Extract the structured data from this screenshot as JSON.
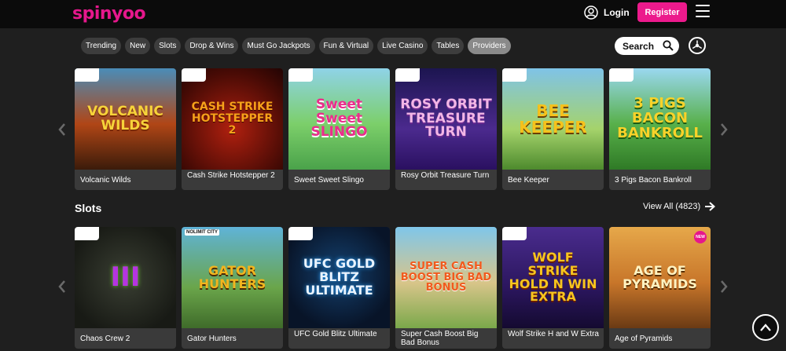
{
  "header": {
    "logo": "spinyoo",
    "login_label": "Login",
    "register_label": "Register",
    "brand_color": "#ec1a8c"
  },
  "tabs": [
    {
      "label": "Trending"
    },
    {
      "label": "New"
    },
    {
      "label": "Slots"
    },
    {
      "label": "Drop & Wins"
    },
    {
      "label": "Must Go Jackpots"
    },
    {
      "label": "Fun & Virtual"
    },
    {
      "label": "Live Casino"
    },
    {
      "label": "Tables"
    },
    {
      "label": "Providers",
      "active": true
    }
  ],
  "search": {
    "label": "Search"
  },
  "featured": {
    "games": [
      {
        "name": "Volcanic Wilds",
        "art": "VOLCANIC WILDS"
      },
      {
        "name": "Cash Strike Hotstepper 2",
        "art": "CASH STRIKE HOTSTEPPER 2"
      },
      {
        "name": "Sweet Sweet Slingo",
        "art": "Sweet Sweet SLINGO"
      },
      {
        "name": "Rosy Orbit Treasure Turn",
        "art": "ROSY ORBIT TREASURE TURN"
      },
      {
        "name": "Bee Keeper",
        "art": "BEE KEEPER"
      },
      {
        "name": "3 Pigs Bacon Bankroll",
        "art": "3 PIGS BACON BANKROLL"
      }
    ]
  },
  "slots": {
    "title": "Slots",
    "view_all_label": "View All (4823)",
    "games": [
      {
        "name": "Chaos Crew 2",
        "art": "III"
      },
      {
        "name": "Gator Hunters",
        "art": "GATOR HUNTERS",
        "provider": "NOLIMIT CITY"
      },
      {
        "name": "UFC Gold Blitz Ultimate",
        "art": "UFC GOLD BLITZ ULTIMATE"
      },
      {
        "name": "Super Cash Boost Big Bad Bonus",
        "art": "SUPER CASH BOOST BIG BAD BONUS"
      },
      {
        "name": "Wolf Strike H and W Extra",
        "art": "WOLF STRIKE HOLD N WIN EXTRA"
      },
      {
        "name": "Age of Pyramids",
        "art": "AGE OF PYRAMIDS",
        "badge": "NEW"
      }
    ]
  }
}
